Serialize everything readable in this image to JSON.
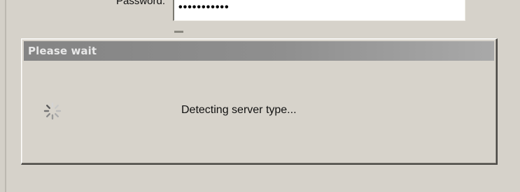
{
  "login_form": {
    "password_label": "Password:",
    "password_value": "•••••••••••"
  },
  "wait_dialog": {
    "title": "Please wait",
    "status_message": "Detecting server type...",
    "spinner_icon": "loading-spinner-icon"
  },
  "colors": {
    "window_background": "#d4d0c8",
    "title_bar_start": "#848484",
    "title_bar_end": "#a9a9a9",
    "title_text": "#e8e8e8"
  }
}
